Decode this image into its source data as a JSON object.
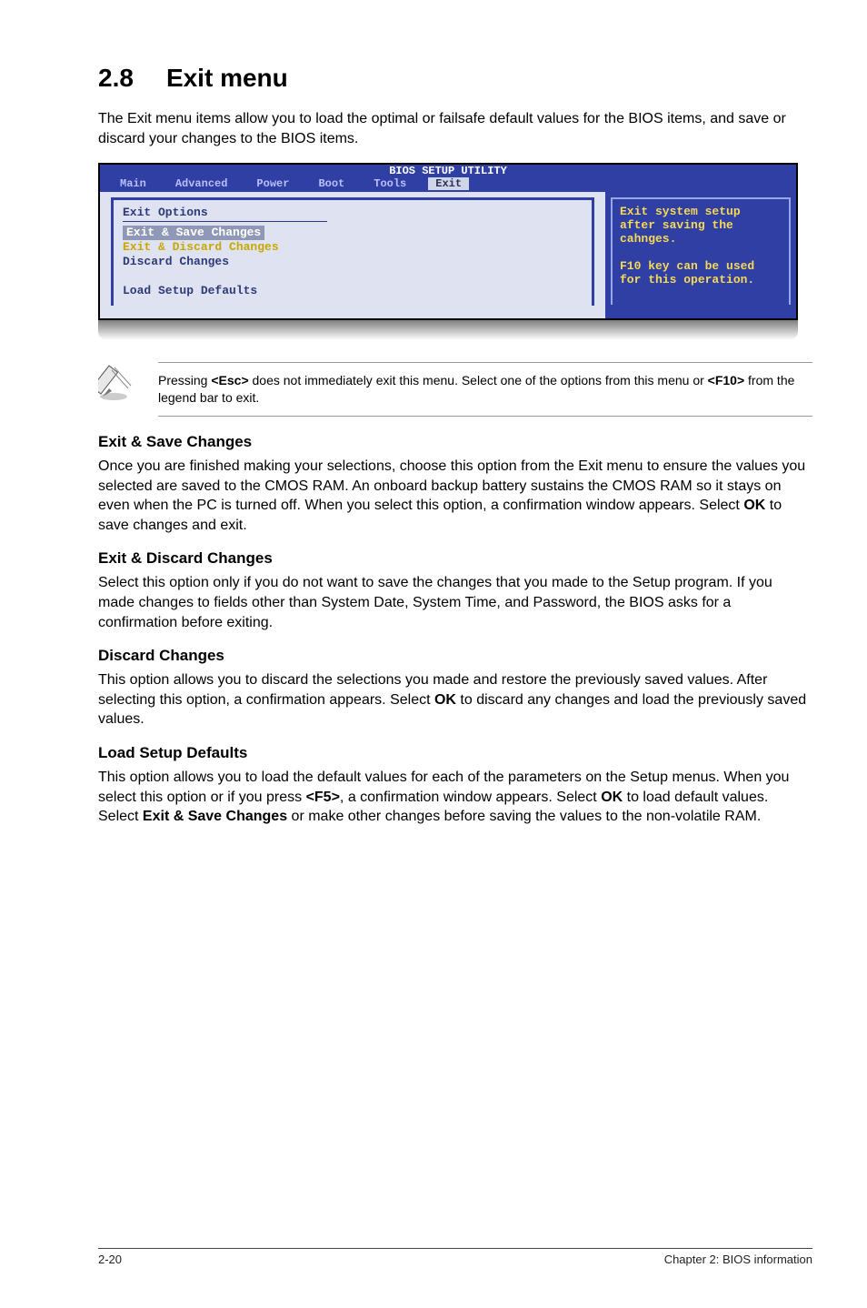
{
  "heading": {
    "number": "2.8",
    "title": "Exit menu"
  },
  "intro": "The Exit menu items allow you to load the optimal or failsafe default values for the BIOS items, and save or discard your changes to the BIOS items.",
  "bios": {
    "title": "BIOS SETUP UTILITY",
    "menu": {
      "items": [
        "Main",
        "Advanced",
        "Power",
        "Boot",
        "Tools"
      ],
      "active": "Exit"
    },
    "left": {
      "title": "Exit Options",
      "items": [
        {
          "label": "Exit & Save Changes",
          "style": "selected"
        },
        {
          "label": "Exit & Discard Changes",
          "style": "yellow"
        },
        {
          "label": "Discard Changes",
          "style": "blue"
        },
        {
          "label": "",
          "style": "blank"
        },
        {
          "label": "Load Setup Defaults",
          "style": "blue"
        }
      ]
    },
    "right": {
      "lines": [
        "Exit system setup",
        "after saving the",
        "cahnges.",
        "",
        "F10 key can be used",
        "for this operation."
      ]
    }
  },
  "note": {
    "text_parts": [
      "Pressing ",
      "<Esc>",
      " does not immediately exit this menu. Select one of the options from this menu or ",
      "<F10>",
      " from the legend bar to exit."
    ]
  },
  "sections": [
    {
      "title": "Exit & Save Changes",
      "body_parts": [
        "Once you are finished making your selections, choose this option from the Exit menu to ensure the values you selected are saved to the CMOS RAM. An onboard backup battery sustains the CMOS RAM so it stays on even when the PC is turned off. When you select this option, a confirmation window appears. Select ",
        "OK",
        " to save changes and exit."
      ]
    },
    {
      "title": "Exit & Discard Changes",
      "body_parts": [
        "Select this option only if you do not want to save the changes that you made to the Setup program. If you made changes to fields other than System Date, System Time, and Password, the BIOS asks for a confirmation before exiting."
      ]
    },
    {
      "title": "Discard Changes",
      "body_parts": [
        "This option allows you to discard the selections you made and restore the previously saved values. After selecting this option, a confirmation appears. Select ",
        "OK",
        " to discard any changes and load the previously saved values."
      ]
    },
    {
      "title": "Load Setup Defaults",
      "body_parts": [
        "This option allows you to load the default values for each of the parameters on the Setup menus. When you select this option or if you press ",
        "<F5>",
        ", a confirmation window appears. Select ",
        "OK",
        " to load default values. Select ",
        "Exit & Save Changes",
        " or make other changes before saving the values to the non-volatile RAM."
      ]
    }
  ],
  "footer": {
    "left": "2-20",
    "right": "Chapter 2: BIOS information"
  }
}
